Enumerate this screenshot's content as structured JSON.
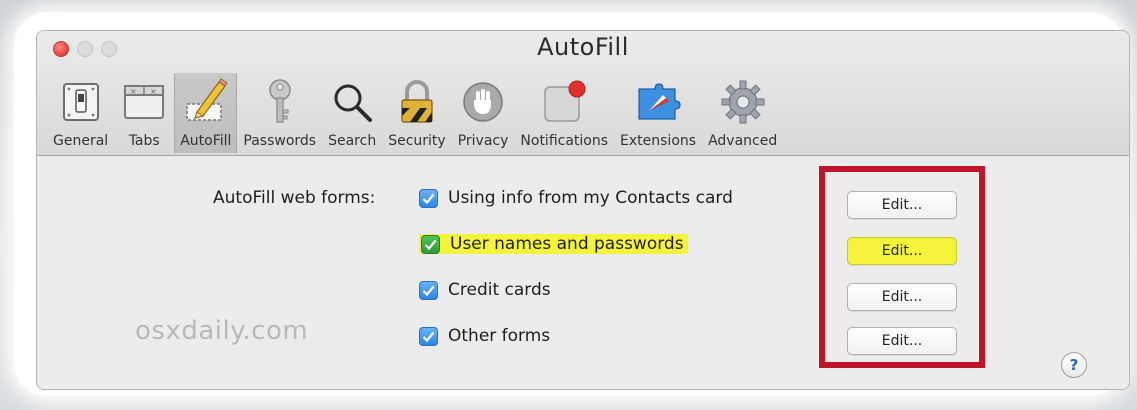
{
  "window": {
    "title": "AutoFill"
  },
  "toolbar": {
    "items": [
      {
        "label": "General",
        "icon": "general-switch-icon"
      },
      {
        "label": "Tabs",
        "icon": "tabs-icon"
      },
      {
        "label": "AutoFill",
        "icon": "pencil-form-icon",
        "selected": true
      },
      {
        "label": "Passwords",
        "icon": "key-icon"
      },
      {
        "label": "Search",
        "icon": "magnifier-icon"
      },
      {
        "label": "Security",
        "icon": "padlock-icon"
      },
      {
        "label": "Privacy",
        "icon": "hand-icon"
      },
      {
        "label": "Notifications",
        "icon": "notification-badge-icon"
      },
      {
        "label": "Extensions",
        "icon": "compass-icon"
      },
      {
        "label": "Advanced",
        "icon": "gear-icon"
      }
    ]
  },
  "autofill": {
    "label": "AutoFill web forms:",
    "options": [
      {
        "label": "Using info from my Contacts card",
        "checked": true,
        "edit": "Edit..."
      },
      {
        "label": "User names and passwords",
        "checked": true,
        "highlighted": true,
        "edit": "Edit..."
      },
      {
        "label": "Credit cards",
        "checked": true,
        "edit": "Edit..."
      },
      {
        "label": "Other forms",
        "checked": true,
        "edit": "Edit..."
      }
    ]
  },
  "watermark": "osxdaily.com",
  "help": "?",
  "colors": {
    "checkbox_blue": "#2a86e6",
    "checkbox_green": "#2c9a3a",
    "highlight_yellow": "#f4f43a",
    "annotation_red": "#c0142a"
  }
}
